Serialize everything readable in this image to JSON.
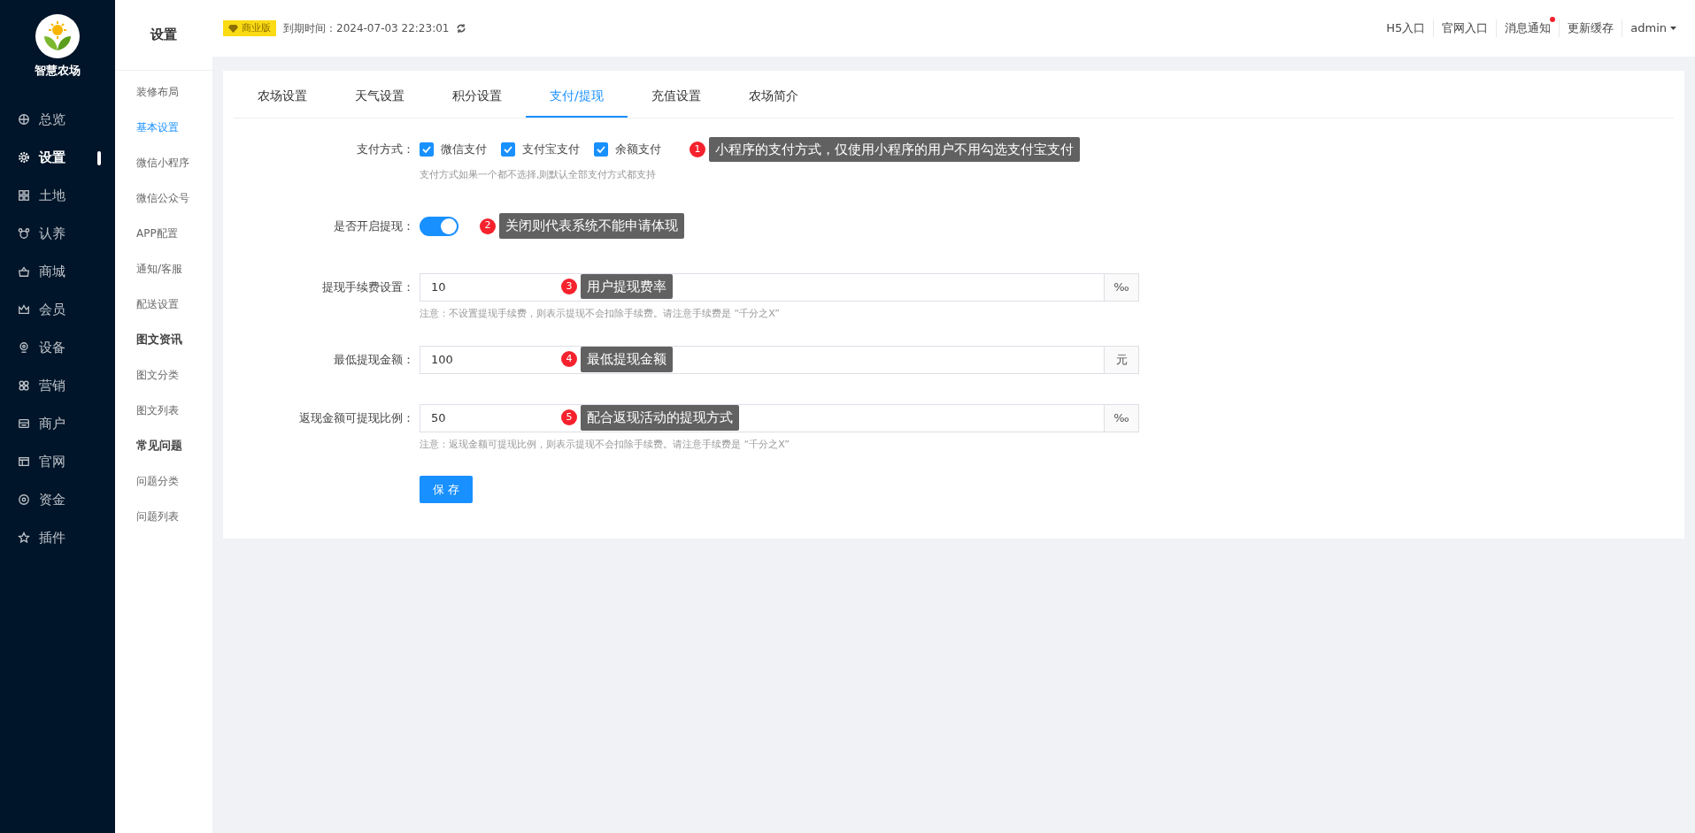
{
  "logo": {
    "text": "智慧农场"
  },
  "nav": [
    {
      "label": "总览",
      "selected": false
    },
    {
      "label": "设置",
      "selected": true
    },
    {
      "label": "土地",
      "selected": false
    },
    {
      "label": "认养",
      "selected": false
    },
    {
      "label": "商城",
      "selected": false
    },
    {
      "label": "会员",
      "selected": false
    },
    {
      "label": "设备",
      "selected": false
    },
    {
      "label": "营销",
      "selected": false
    },
    {
      "label": "商户",
      "selected": false
    },
    {
      "label": "官网",
      "selected": false
    },
    {
      "label": "资金",
      "selected": false
    },
    {
      "label": "插件",
      "selected": false
    }
  ],
  "subnav": {
    "title": "设置",
    "items": [
      {
        "kind": "link",
        "label": "装修布局",
        "selected": false
      },
      {
        "kind": "link",
        "label": "基本设置",
        "selected": true
      },
      {
        "kind": "link",
        "label": "微信小程序",
        "selected": false
      },
      {
        "kind": "link",
        "label": "微信公众号",
        "selected": false
      },
      {
        "kind": "link",
        "label": "APP配置",
        "selected": false
      },
      {
        "kind": "link",
        "label": "通知/客服",
        "selected": false
      },
      {
        "kind": "link",
        "label": "配送设置",
        "selected": false
      },
      {
        "kind": "heading",
        "label": "图文资讯"
      },
      {
        "kind": "link",
        "label": "图文分类",
        "selected": false
      },
      {
        "kind": "link",
        "label": "图文列表",
        "selected": false
      },
      {
        "kind": "heading",
        "label": "常见问题"
      },
      {
        "kind": "link",
        "label": "问题分类",
        "selected": false
      },
      {
        "kind": "link",
        "label": "问题列表",
        "selected": false
      }
    ]
  },
  "topbar": {
    "edition": "商业版",
    "expiry": "到期时间：2024-07-03 22:23:01",
    "links": [
      {
        "label": "H5入口",
        "dot": false
      },
      {
        "label": "官网入口",
        "dot": false
      },
      {
        "label": "消息通知",
        "dot": true
      },
      {
        "label": "更新缓存",
        "dot": false
      }
    ],
    "user": "admin"
  },
  "tabs": [
    {
      "label": "农场设置",
      "selected": false
    },
    {
      "label": "天气设置",
      "selected": false
    },
    {
      "label": "积分设置",
      "selected": false
    },
    {
      "label": "支付/提现",
      "selected": true
    },
    {
      "label": "充值设置",
      "selected": false
    },
    {
      "label": "农场简介",
      "selected": false
    }
  ],
  "payment": {
    "label": "支付方式：",
    "options": [
      {
        "label": "微信支付",
        "checked": true
      },
      {
        "label": "支付宝支付",
        "checked": true
      },
      {
        "label": "余额支付",
        "checked": true
      }
    ],
    "hint": "支付方式如果一个都不选择,则默认全部支付方式都支持",
    "annotation": {
      "number": "1",
      "text": "小程序的支付方式，仅使用小程序的用户不用勾选支付宝支付"
    }
  },
  "withdraw_switch": {
    "label": "是否开启提现：",
    "on": true,
    "annotation": {
      "number": "2",
      "text": "关闭则代表系统不能申请体现"
    }
  },
  "fields": [
    {
      "label": "提现手续费设置：",
      "value": "10",
      "unit": "‰",
      "note": "注意：不设置提现手续费，则表示提现不会扣除手续费。请注意手续费是 “千分之X”",
      "annotation": {
        "number": "3",
        "text": "用户提现费率"
      }
    },
    {
      "label": "最低提现金额：",
      "value": "100",
      "unit": "元",
      "annotation": {
        "number": "4",
        "text": "最低提现金额"
      }
    },
    {
      "label": "返现金额可提现比例：",
      "value": "50",
      "unit": "‰",
      "note": "注意：返现金额可提现比例，则表示提现不会扣除手续费。请注意手续费是 “千分之X”",
      "annotation": {
        "number": "5",
        "text": "配合返现活动的提现方式"
      }
    }
  ],
  "save": "保 存"
}
